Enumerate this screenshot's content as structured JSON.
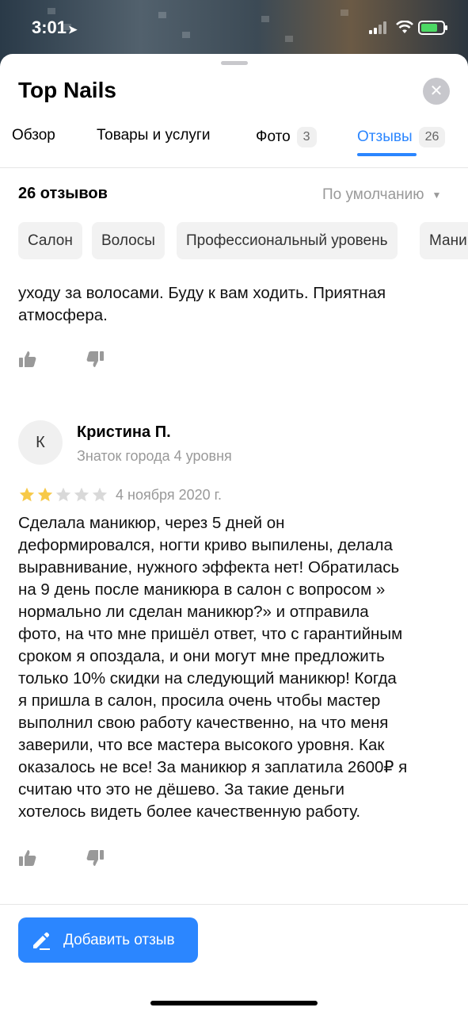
{
  "status_bar": {
    "time": "3:01",
    "location_icon": "location-arrow-icon",
    "battery_color": "#4cd964"
  },
  "header": {
    "title": "Top Nails",
    "close_icon": "close-icon"
  },
  "tabs": [
    {
      "label": "Обзор",
      "badge": null
    },
    {
      "label": "Товары и услуги",
      "badge": null
    },
    {
      "label": "Фото",
      "badge": "3"
    },
    {
      "label": "Отзывы",
      "badge": "26",
      "active": true
    }
  ],
  "reviews_header": {
    "count": "26 отзывов",
    "sort": "По умолчанию"
  },
  "chips": [
    "Салон",
    "Волосы",
    "Профессиональный уровень",
    "Мани"
  ],
  "prev_review": {
    "text_line1": "уходу  за волосами. Буду к вам ходить. Приятная",
    "text_line2": "атмосфера."
  },
  "review": {
    "avatar_letter": "К",
    "author": "Кристина П.",
    "level": "Знаток города 4 уровня",
    "rating": 2,
    "rating_max": 5,
    "date": "4 ноября 2020 г.",
    "lines": [
      "Сделала маникюр, через 5 дней он",
      "деформировался, ногти криво выпилены, делала",
      "выравнивание, нужного эффекта нет! Обратилась",
      "на 9 день после маникюра в салон с вопросом »",
      "нормально ли сделан маникюр?» и отправила",
      "фото, на что мне пришёл ответ, что с гарантийным",
      "сроком я опоздала, и они могут мне предложить",
      "только 10% скидки на следующий маникюр! Когда",
      "я пришла в салон, просила очень чтобы мастер",
      "выполнил свою работу качественно, на что меня",
      "заверили, что все мастера высокого уровня. Как",
      "оказалось не все! За маникюр я заплатила 2600₽ я",
      "считаю что это не дёшево. За такие деньги",
      "хотелось видеть более качественную работу."
    ]
  },
  "actions": {
    "add_review": "Добавить отзыв"
  },
  "colors": {
    "accent": "#2b86ff",
    "star_filled": "#f7c948",
    "star_empty": "#d9d9d9"
  }
}
